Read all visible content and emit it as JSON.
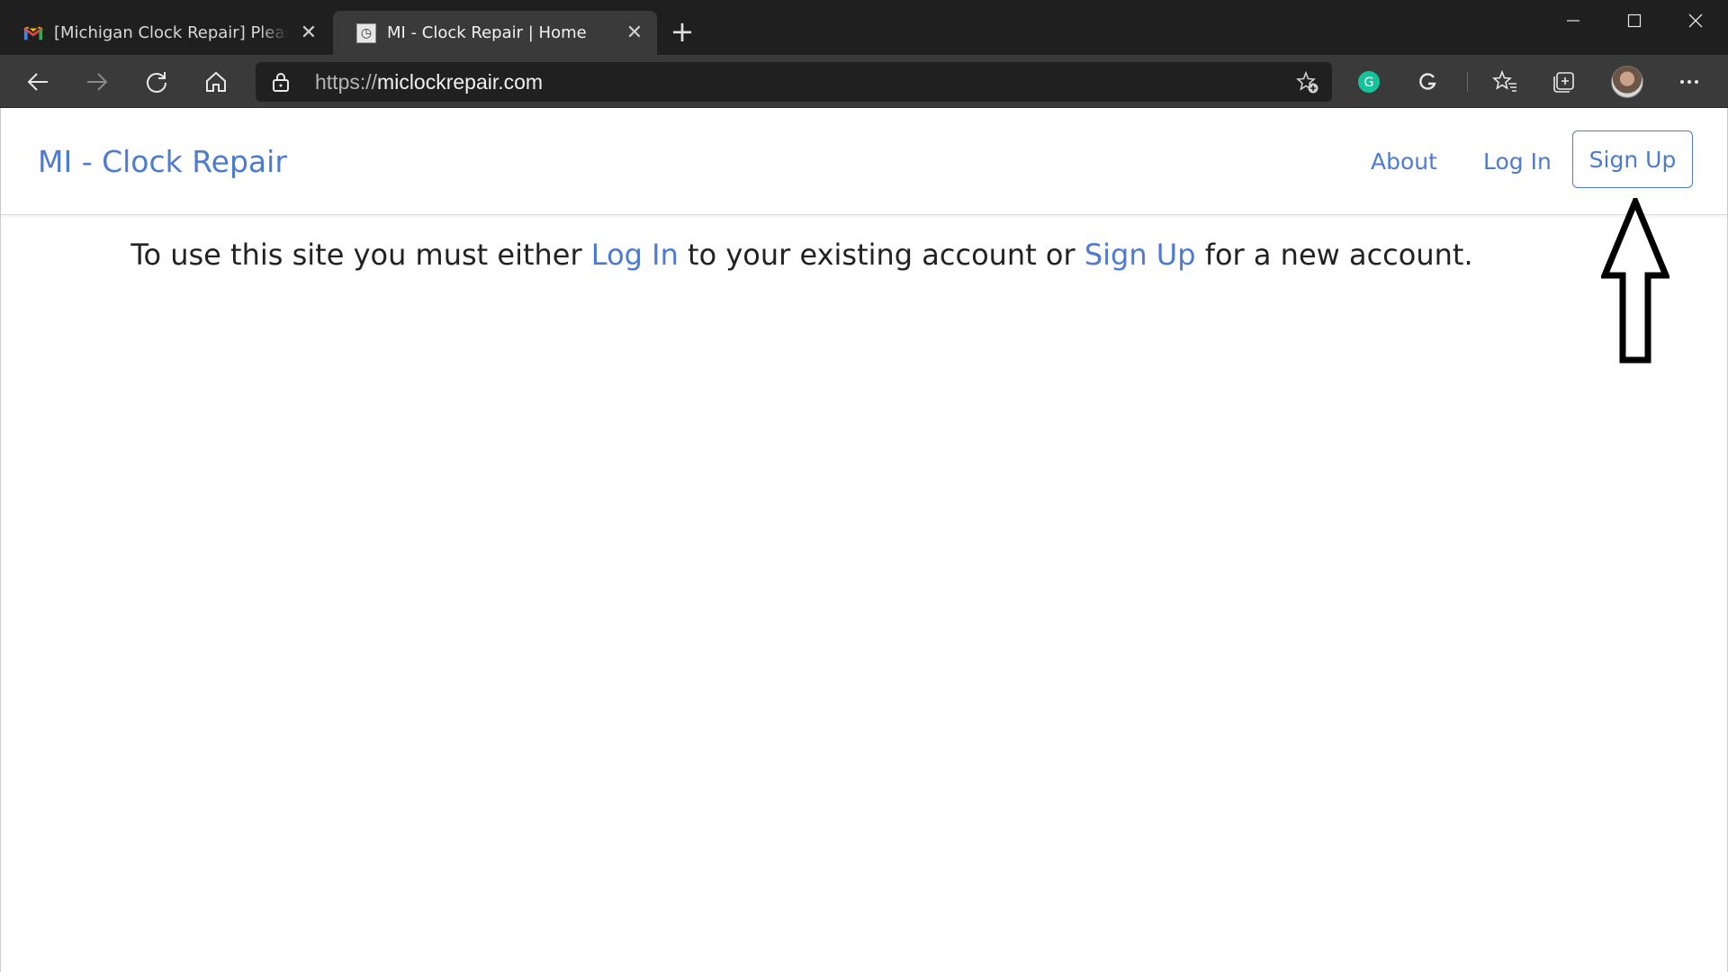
{
  "browser": {
    "tabs": [
      {
        "title": "[Michigan Clock Repair] Please Confirm",
        "active": false
      },
      {
        "title": "MI - Clock Repair | Home",
        "active": true
      }
    ],
    "url_scheme": "https://",
    "url_host": "miclockrepair.com"
  },
  "nav": {
    "brand": "MI - Clock Repair",
    "about": "About",
    "login": "Log In",
    "signup": "Sign Up"
  },
  "main": {
    "part1": "To use this site you must either ",
    "login_link": "Log In",
    "part2": " to your existing account or ",
    "signup_link": "Sign Up",
    "part3": " for a new account."
  },
  "colors": {
    "link": "#4d7bd1",
    "chrome_dark": "#1f1f1f",
    "toolbar": "#3a3a3a"
  }
}
